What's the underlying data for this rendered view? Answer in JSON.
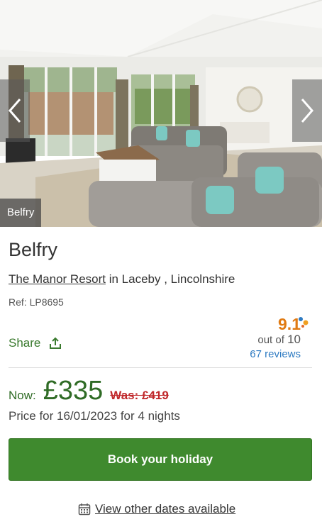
{
  "listing": {
    "image_caption": "Belfry",
    "title": "Belfry",
    "resort_link": "The Manor Resort",
    "location_rest": " in Laceby , Lincolnshire",
    "ref": "Ref: LP8695"
  },
  "share": {
    "label": "Share",
    "icon": "share-icon"
  },
  "rating": {
    "score": "9.1",
    "out_of_prefix": "out of ",
    "out_of_max": "10",
    "reviews": "67 reviews",
    "score_color": "#e07a12"
  },
  "pricing": {
    "now_label": "Now:",
    "price": "£335",
    "was": "Was: £419",
    "note": "Price for 16/01/2023 for 4 nights"
  },
  "actions": {
    "book_label": "Book your holiday",
    "dates_label": "View other dates available",
    "dates_icon": "calendar-icon"
  },
  "colors": {
    "accent_green": "#3f8a2e",
    "price_green": "#2f6b25",
    "was_red": "#c0282b",
    "link_blue": "#2f7bc2"
  }
}
